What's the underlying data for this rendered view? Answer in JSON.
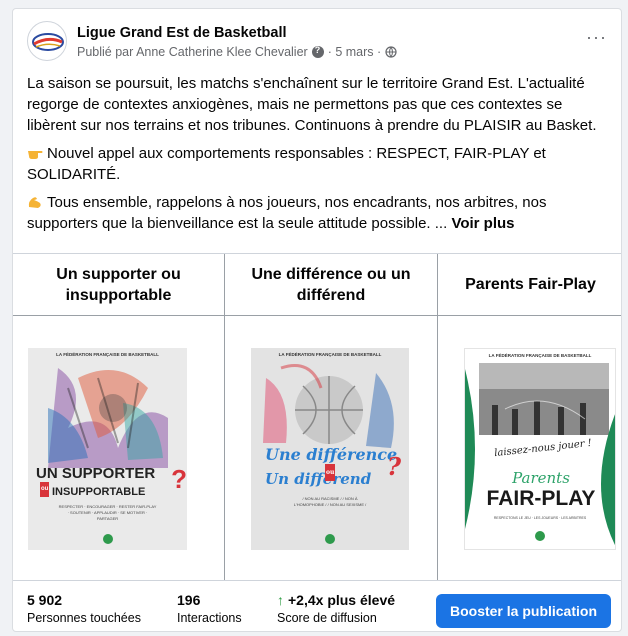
{
  "post": {
    "page_name": "Ligue Grand Est de Basketball",
    "meta_prefix": "Publié par Anne Catherine Klee Chevalier",
    "meta_date": "· 5 mars ·",
    "more_label": "···",
    "paragraph1": "La saison se poursuit, les matchs s'enchaînent sur le territoire Grand Est. L'actualité regorge de contextes anxiogènes, mais ne permettons pas que ces contextes se libèrent sur nos terrains et nos tribunes. Continuons à prendre du PLAISIR au Basket.",
    "paragraph2": "Nouvel appel aux comportements responsables : RESPECT, FAIR-PLAY et SOLIDARITÉ.",
    "paragraph3": "Tous ensemble, rappelons à nos joueurs, nos encadrants, nos arbitres, nos supporters que la bienveillance est la seule attitude possible. ...",
    "see_more": "Voir plus"
  },
  "grid": {
    "columns": [
      {
        "title": "Un supporter ou insupportable"
      },
      {
        "title": "Une différence ou un différend"
      },
      {
        "title": "Parents Fair-Play"
      }
    ]
  },
  "posters": {
    "p1": {
      "header": "LA FÉDÉRATION FRANÇAISE DE BASKETBALL",
      "line1": "UN SUPPORTER",
      "ou": "ou",
      "line2": "INSUPPORTABLE",
      "q": "?",
      "sub": "RESPECTER · ENCOURAGER · RESTER FAIR-PLAY · SOUTENIR · APPLAUDIR · SE MOTIVER · PARTAGER"
    },
    "p2": {
      "header": "LA FÉDÉRATION FRANÇAISE DE BASKETBALL",
      "line1": "Une différence",
      "ou": "ou",
      "line2": "Un différend",
      "q": "?",
      "sub": "/ NON AU RACISME / / NON À L'HOMOPHOBIE / / NON AU SEXISME /"
    },
    "p3": {
      "header": "LA FÉDÉRATION FRANÇAISE DE BASKETBALL",
      "quote": "laissez-nous jouer !",
      "script": "Parents",
      "big": "FAIR-PLAY",
      "sub": "RESPECTONS LE JEU · LES JOUEURS · LES ARBITRES"
    }
  },
  "stats": {
    "reach_value": "5 902",
    "reach_label": "Personnes touchées",
    "interactions_value": "196",
    "interactions_label": "Interactions",
    "score_value": "+2,4x plus élevé",
    "score_label": "Score de diffusion",
    "score_arrow": "↑"
  },
  "actions": {
    "boost_label": "Booster la publication"
  },
  "colors": {
    "primary": "#1b74e4",
    "positive": "#2f9e44",
    "poster3_green": "#1f8a56"
  }
}
